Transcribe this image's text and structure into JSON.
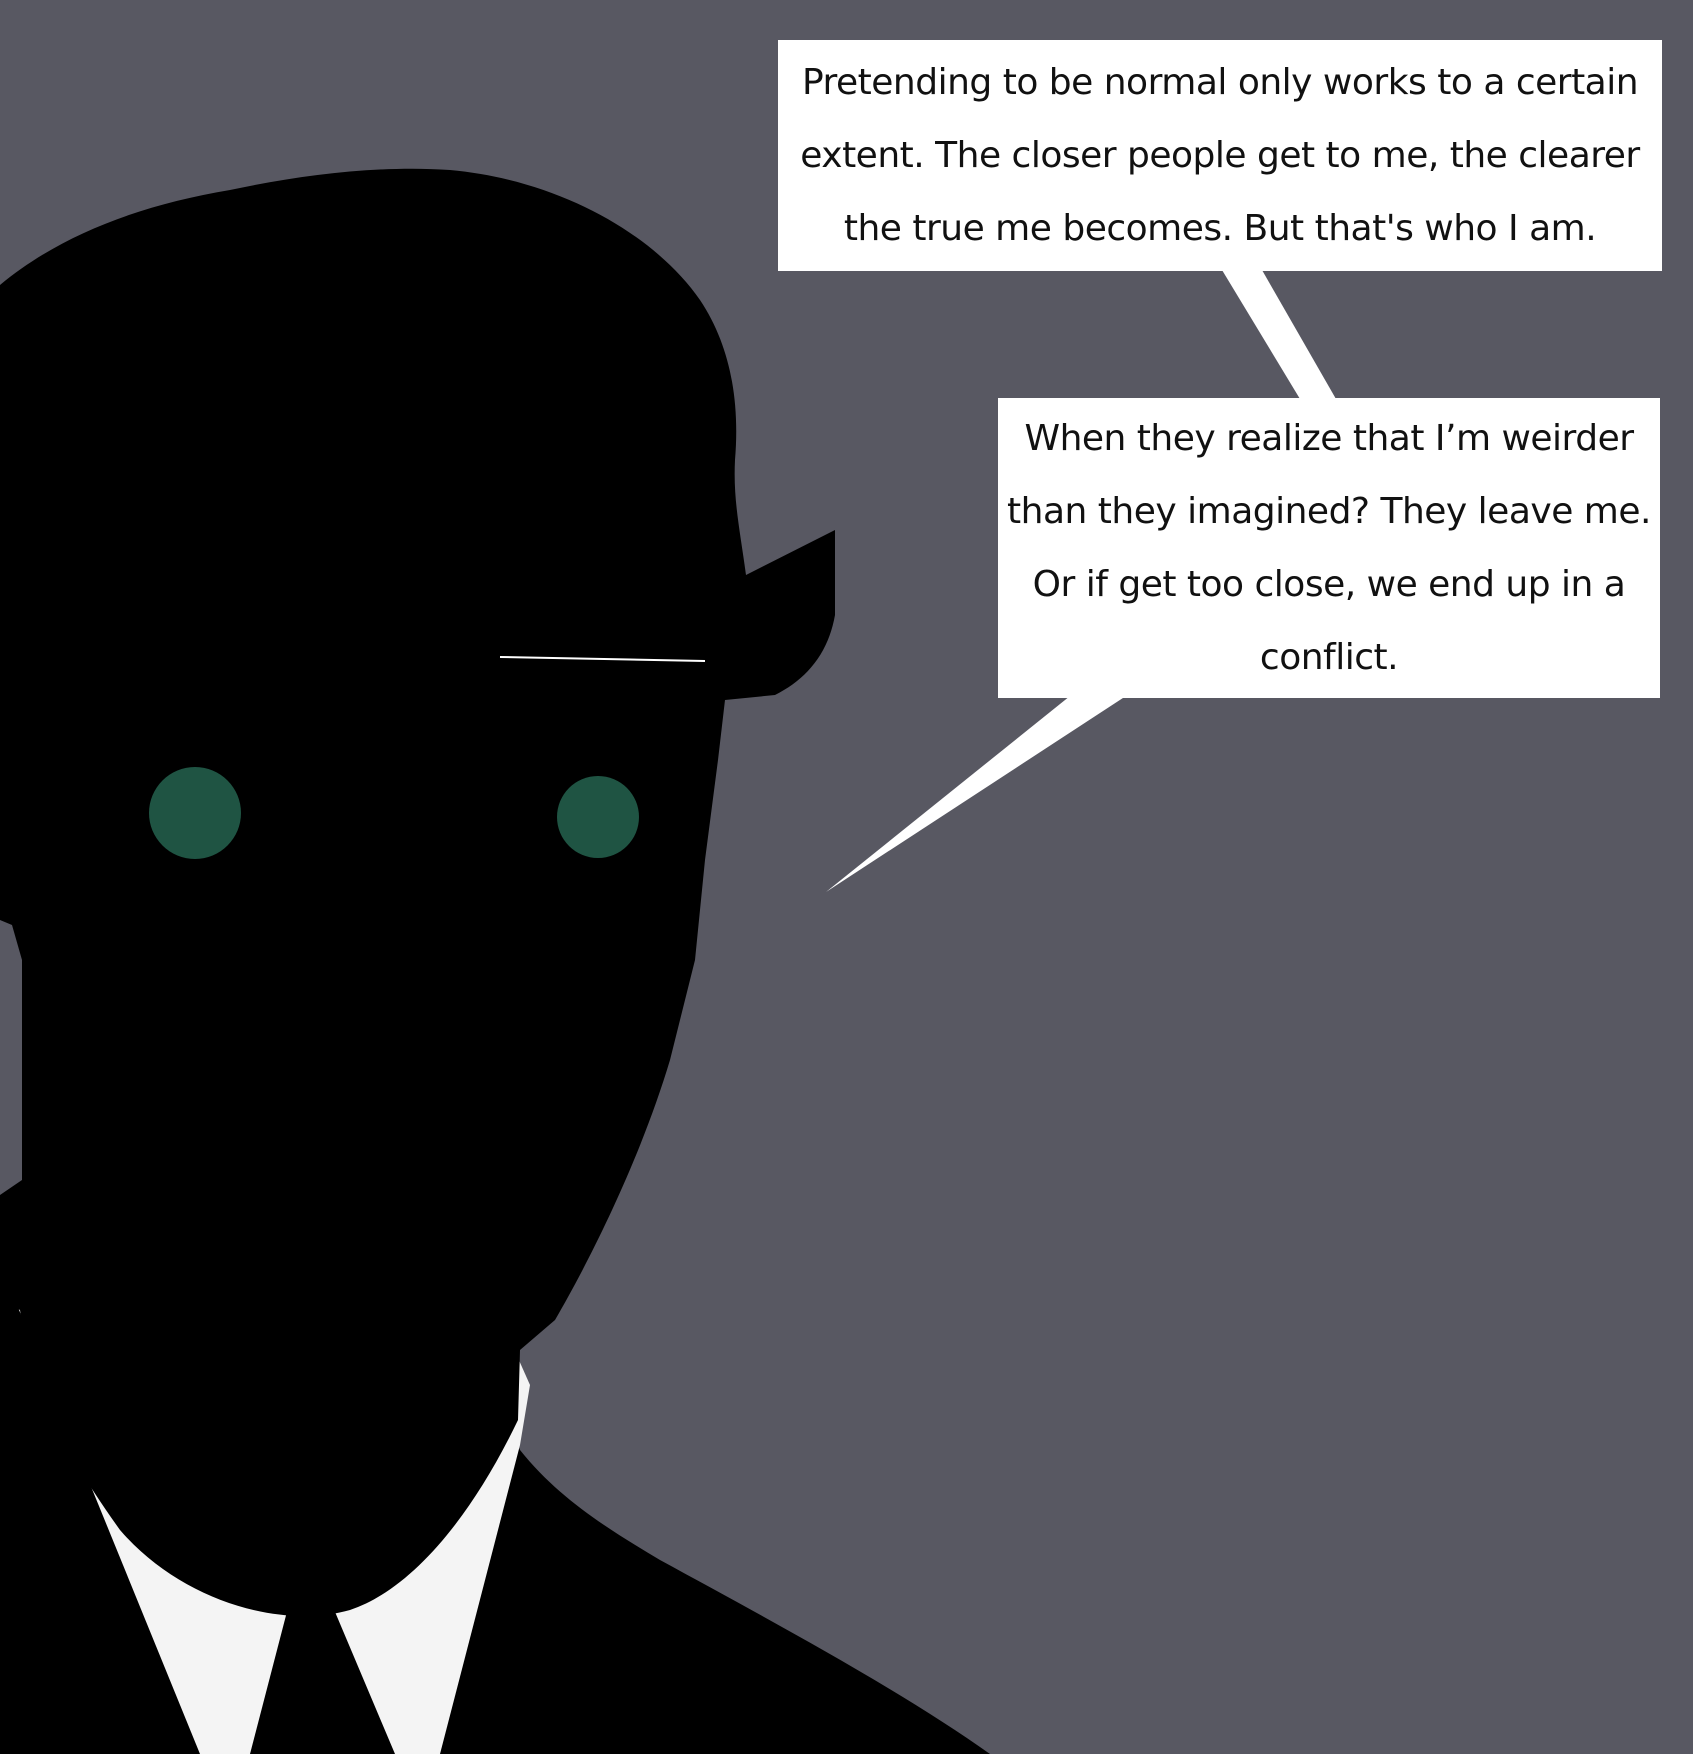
{
  "speech_bubbles": [
    {
      "text": "Pretending to be normal only works to a certain extent. The closer people get to me, the clearer the true me becomes. But that's who I am."
    },
    {
      "text": "When they realize that I’m weirder than they imagined? They leave me. Or if get too close, we end up in a conflict."
    }
  ],
  "colors": {
    "background": "#585862",
    "silhouette": "#000000",
    "eyes": "#1f5443",
    "collar": "#f4f4f4",
    "bubble": "#ffffff",
    "text": "#111111"
  },
  "icons": {
    "figure": "silhouette-figure",
    "eyes": "eye-dots"
  }
}
